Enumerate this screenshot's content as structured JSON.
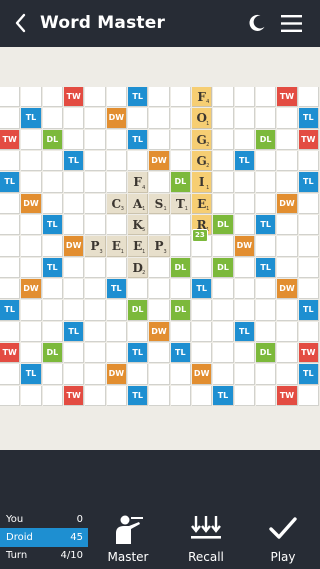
{
  "header": {
    "title": "Word Master",
    "back_icon": "chevron-left-icon",
    "theme_icon": "moon-icon",
    "menu_icon": "hamburger-menu-icon"
  },
  "board": {
    "size": 15,
    "colors": {
      "TL": "#1e8fd1",
      "DL": "#7cb93b",
      "TW": "#e34c42",
      "DW": "#e28e30",
      "tile": "#e7dfcb",
      "highlight": "#f6ce73"
    },
    "rows": [
      "...TW..TL...+TL..TW...",
      "",
      "",
      "",
      "",
      "",
      "",
      "",
      "",
      "",
      "",
      "",
      "",
      "",
      ""
    ],
    "layout": [
      "...TW..TL...---TL..TW...",
      "x"
    ],
    "grid": [
      [
        "",
        "",
        "",
        "TW",
        "",
        "",
        "TL",
        "",
        "",
        "",
        "",
        "",
        "",
        "TW",
        ""
      ],
      [
        "",
        "TL",
        "",
        "",
        "",
        "DW",
        "",
        "",
        "",
        "",
        "",
        "",
        "",
        "",
        "TL"
      ],
      [
        "TW",
        "",
        "DL",
        "",
        "",
        "",
        "TL",
        "",
        "",
        "",
        "",
        "",
        "DL",
        "",
        "TW"
      ],
      [
        "",
        "",
        "",
        "TL",
        "",
        "",
        "",
        "DW",
        "",
        "",
        "",
        "TL",
        "",
        "",
        ""
      ],
      [
        "TL",
        "",
        "",
        "",
        "",
        "",
        "",
        "",
        "DL",
        "",
        "",
        "",
        "",
        "",
        "TL"
      ],
      [
        "",
        "DW",
        "",
        "",
        "",
        "",
        "",
        "",
        "",
        "",
        "",
        "",
        "",
        "DW",
        ""
      ],
      [
        "",
        "",
        "TL",
        "",
        "",
        "",
        "",
        "",
        "",
        "",
        "DL",
        "",
        "TL",
        "",
        ""
      ],
      [
        "",
        "",
        "",
        "DW",
        "DL",
        "",
        "",
        "",
        "",
        "",
        "",
        "DW",
        "",
        "",
        ""
      ],
      [
        "",
        "",
        "TL",
        "",
        "",
        "",
        "",
        "",
        "DL",
        "",
        "DL",
        "",
        "TL",
        "",
        ""
      ],
      [
        "",
        "DW",
        "",
        "",
        "",
        "TL",
        "",
        "",
        "",
        "TL",
        "",
        "",
        "",
        "DW",
        ""
      ],
      [
        "TL",
        "",
        "",
        "",
        "",
        "",
        "DL",
        "",
        "DL",
        "",
        "",
        "",
        "",
        "",
        "TL"
      ],
      [
        "",
        "",
        "",
        "TL",
        "",
        "",
        "",
        "DW",
        "",
        "",
        "",
        "TL",
        "",
        "",
        ""
      ],
      [
        "TW",
        "",
        "DL",
        "",
        "",
        "",
        "TL",
        "",
        "TL",
        "",
        "",
        "",
        "DL",
        "",
        "TW"
      ],
      [
        "",
        "TL",
        "",
        "",
        "",
        "DW",
        "",
        "",
        "",
        "DW",
        "",
        "",
        "",
        "",
        "TL"
      ],
      [
        "",
        "",
        "",
        "TW",
        "",
        "",
        "TL",
        "",
        "",
        "",
        "TL",
        "",
        "",
        "TW",
        ""
      ]
    ],
    "tiles": [
      {
        "row": 0,
        "col": 9,
        "letter": "F",
        "points": "4",
        "highlight": true
      },
      {
        "row": 1,
        "col": 9,
        "letter": "O",
        "points": "1",
        "highlight": true
      },
      {
        "row": 2,
        "col": 9,
        "letter": "G",
        "points": "2",
        "highlight": true
      },
      {
        "row": 3,
        "col": 9,
        "letter": "G",
        "points": "2",
        "highlight": true
      },
      {
        "row": 4,
        "col": 9,
        "letter": "I",
        "points": "1",
        "highlight": true
      },
      {
        "row": 5,
        "col": 9,
        "letter": "E",
        "points": "1",
        "highlight": true
      },
      {
        "row": 6,
        "col": 9,
        "letter": "R",
        "points": "1",
        "highlight": true
      },
      {
        "row": 4,
        "col": 6,
        "letter": "F",
        "points": "4",
        "highlight": false
      },
      {
        "row": 5,
        "col": 5,
        "letter": "C",
        "points": "3",
        "highlight": false
      },
      {
        "row": 5,
        "col": 6,
        "letter": "A",
        "points": "1",
        "highlight": false
      },
      {
        "row": 5,
        "col": 7,
        "letter": "S",
        "points": "1",
        "highlight": false
      },
      {
        "row": 5,
        "col": 8,
        "letter": "T",
        "points": "1",
        "highlight": false
      },
      {
        "row": 6,
        "col": 6,
        "letter": "K",
        "points": "5",
        "highlight": false
      },
      {
        "row": 7,
        "col": 6,
        "letter": "E",
        "points": "1",
        "highlight": false
      },
      {
        "row": 7,
        "col": 4,
        "letter": "P",
        "points": "3",
        "highlight": false
      },
      {
        "row": 7,
        "col": 5,
        "letter": "E",
        "points": "1",
        "highlight": false
      },
      {
        "row": 7,
        "col": 7,
        "letter": "P",
        "points": "3",
        "highlight": false
      },
      {
        "row": 8,
        "col": 6,
        "letter": "D",
        "points": "2",
        "highlight": false
      }
    ],
    "score_badge": "23"
  },
  "scores": {
    "you_label": "You",
    "you_value": "0",
    "droid_label": "Droid",
    "droid_value": "45",
    "turn_label": "Turn",
    "turn_value": "4/10"
  },
  "actions": {
    "master_label": "Master",
    "recall_label": "Recall",
    "play_label": "Play"
  }
}
